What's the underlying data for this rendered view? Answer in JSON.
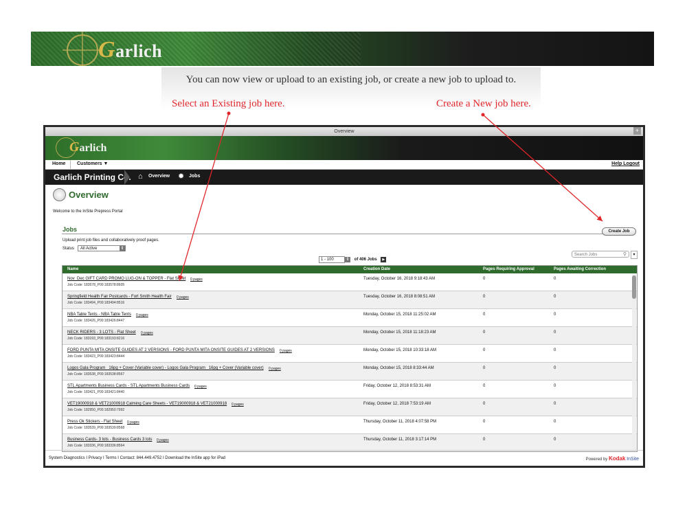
{
  "banner": {
    "logo_initial": "G",
    "logo_rest": "arlich"
  },
  "instructions": {
    "headline": "You can now view or upload to an existing job, or create a new job to upload to.",
    "callout_existing": "Select an Existing job here.",
    "callout_new": "Create a New job here."
  },
  "window": {
    "title": "Overview",
    "plus": "+"
  },
  "app": {
    "logo_initial": "G",
    "logo_rest": "arlich",
    "menu": {
      "home": "Home",
      "customers": "Customers ▼",
      "help": "Help",
      "logout": "Logout"
    },
    "nav": {
      "company": "Garlich Printing Co.",
      "overview": "Overview",
      "jobs": "Jobs"
    }
  },
  "overview": {
    "title": "Overview",
    "welcome": "Welcome to the InSite Prepress Portal",
    "jobs_heading": "Jobs",
    "create_job": "Create Job",
    "subtitle": "Upload print job files and collaboratively proof pages.",
    "status_label": "Status",
    "status_value": "All Active",
    "search_placeholder": "Search Jobs",
    "pager_range": "1 - 100",
    "pager_of": "of 406 Jobs"
  },
  "table": {
    "headers": {
      "name": "Name",
      "date": "Creation Date",
      "approval": "Pages Requiring Approval",
      "correction": "Pages Awaiting Correction"
    },
    "rows": [
      {
        "name": "Nov_Dec GIFT CARD PROMO LUG-ON & TOPPER - Flat Sheet",
        "pages": "0 pages",
        "code": "Job Code: 183578_P00:183578:8605",
        "date": "Tuesday, October 16, 2018 9:18:43 AM",
        "approval": "0",
        "correction": "0"
      },
      {
        "name": "Springfield Health Fair Postcards - Fort Smith Health Fair",
        "pages": "0 pages",
        "code": "Job Code: 183494_P00:183494:8516",
        "date": "Tuesday, October 16, 2018 8:08:51 AM",
        "approval": "0",
        "correction": "0"
      },
      {
        "name": "NBA Table Tents - NBA Table Tents",
        "pages": "0 pages",
        "code": "Job Code: 183426_P00:183426:8447",
        "date": "Monday, October 15, 2018 11:25:02 AM",
        "approval": "0",
        "correction": "0"
      },
      {
        "name": "NECK RIDERS - 3 LOTS - Flat Sheet",
        "pages": "0 pages",
        "code": "Job Code: 183193_P00:183193:8216",
        "date": "Monday, October 15, 2018 11:18:23 AM",
        "approval": "0",
        "correction": "0"
      },
      {
        "name": "FORD PUNTA MITA ONSITE GUIDES AT 2 VERSIONS - FORD PUNTA MITA ONSITE GUIDES AT 2 VERSIONS",
        "pages": "0 pages",
        "code": "Job Code: 183423_P00:183423:8444",
        "date": "Monday, October 15, 2018 10:33:18 AM",
        "approval": "0",
        "correction": "0"
      },
      {
        "name": "Logos Gala Program_ 16pg + Cover (Variable cover) - Logos Gala Program_ 16pg + Cover (Variable cover)",
        "pages": "0 pages",
        "code": "Job Code: 183538_P00:183538:8567",
        "date": "Monday, October 15, 2018 8:33:44 AM",
        "approval": "0",
        "correction": "0"
      },
      {
        "name": "STL Apartments Business Cards - STL Apartments Business Cards",
        "pages": "0 pages",
        "code": "Job Code: 183421_P00:183421:8440",
        "date": "Friday, October 12, 2018 8:53:31 AM",
        "approval": "0",
        "correction": "0"
      },
      {
        "name": "VET19000918 & VET21000918 Calming Care Sheets - VET19000918 & VET21000918",
        "pages": "0 pages",
        "code": "Job Code: 182950_P00:182950:7992",
        "date": "Friday, October 12, 2018 7:53:19 AM",
        "approval": "0",
        "correction": "0"
      },
      {
        "name": "Press Ok Stickers - Flat Sheet",
        "pages": "0 pages",
        "code": "Job Code: 183539_P00:183539:8568",
        "date": "Thursday, October 11, 2018 4:07:58 PM",
        "approval": "0",
        "correction": "0"
      },
      {
        "name": "Business Cards- 3 lots - Business Cards 3 lots",
        "pages": "0 pages",
        "code": "Job Code: 183336_P00:183336:8564",
        "date": "Thursday, October 11, 2018 3:17:14 PM",
        "approval": "0",
        "correction": "0"
      }
    ]
  },
  "footer": {
    "links": "System Diagnostics  I  Privacy  I  Terms  I  Contact: 844.449.4752  I  Download the InSite app for iPad",
    "powered": "Powered by",
    "kodak": "Kodak",
    "insite": "InSite"
  },
  "colors": {
    "accent_green": "#2f6b2d",
    "callout_red": "#e0262a"
  }
}
